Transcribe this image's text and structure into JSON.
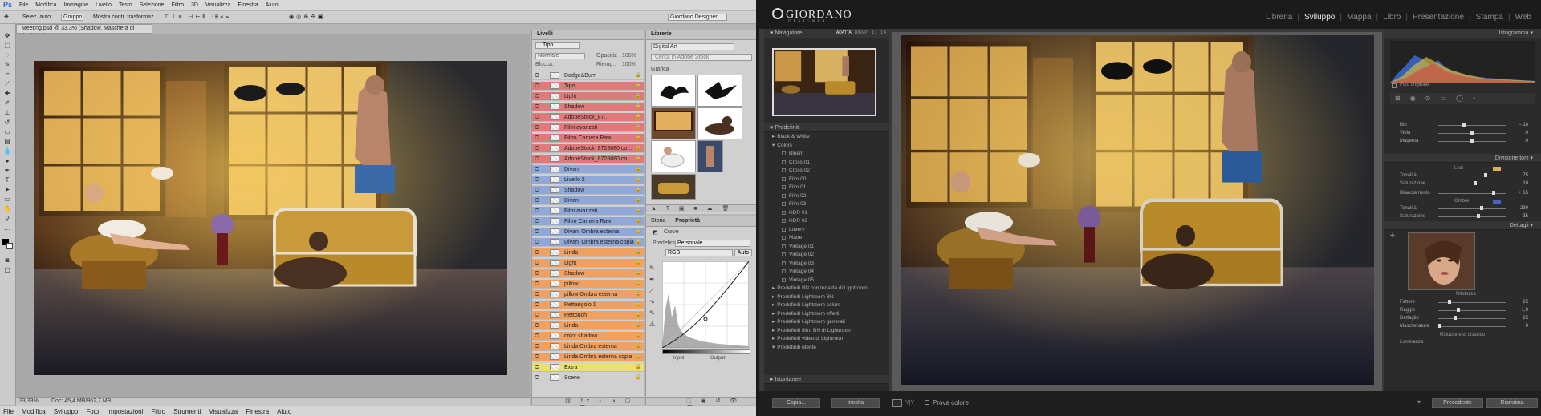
{
  "photoshop": {
    "menu": [
      "File",
      "Modifica",
      "Immagine",
      "Livello",
      "Testo",
      "Selezione",
      "Filtro",
      "3D",
      "Visualizza",
      "Finestra",
      "Aiuto"
    ],
    "options": {
      "auto_select": "Selez. auto:",
      "group_value": "Gruppo",
      "transform": "Mostra contr. trasformaz.",
      "workspace": "Giordano Designer"
    },
    "doc_tab": "Meeting.psd @ 33,3% (Shadow, Maschera di livello/16) *",
    "status": {
      "zoom": "33,33%",
      "doc": "Doc: 45,4 MB/962,7 MB"
    },
    "layers_panel": {
      "title": "Livelli",
      "kind": "Tipo",
      "blend": "Normale",
      "opacity_label": "Opacità:",
      "opacity": "100%",
      "lock_label": "Blocca:",
      "fill_label": "Riemp.:",
      "fill": "100%",
      "layers": [
        {
          "name": "Dodge&Burn",
          "color": "#d0d0d0"
        },
        {
          "name": "Tipo",
          "color": "#e07a7a"
        },
        {
          "name": "Light",
          "color": "#e07a7a"
        },
        {
          "name": "Shadow",
          "color": "#e07a7a"
        },
        {
          "name": "AdobeStock_87...",
          "color": "#e07a7a"
        },
        {
          "name": "Filtri avanzati",
          "color": "#e07a7a"
        },
        {
          "name": "Filtro Camera Raw",
          "color": "#e07a7a"
        },
        {
          "name": "AdobeStock_8728880 co...",
          "color": "#e07a7a"
        },
        {
          "name": "AdobeStock_8728880 co...",
          "color": "#e07a7a"
        },
        {
          "name": "Divani",
          "color": "#8fa8d8"
        },
        {
          "name": "Livello 2",
          "color": "#8fa8d8"
        },
        {
          "name": "Shadow",
          "color": "#8fa8d8"
        },
        {
          "name": "Divani",
          "color": "#8fa8d8"
        },
        {
          "name": "Filtri avanzati",
          "color": "#8fa8d8"
        },
        {
          "name": "Filtro Camera Raw",
          "color": "#8fa8d8"
        },
        {
          "name": "Divani Ombra esterna",
          "color": "#8fa8d8"
        },
        {
          "name": "Divani Ombra esterna copia",
          "color": "#8fa8d8"
        },
        {
          "name": "Linda",
          "color": "#f0a060"
        },
        {
          "name": "Light",
          "color": "#f0a060"
        },
        {
          "name": "Shadow",
          "color": "#f0a060"
        },
        {
          "name": "pillow",
          "color": "#f0a060"
        },
        {
          "name": "pillow Ombra esterna",
          "color": "#f0a060"
        },
        {
          "name": "Rettangolo 1",
          "color": "#f0a060"
        },
        {
          "name": "Rettouch",
          "color": "#f0a060"
        },
        {
          "name": "Linda",
          "color": "#f0a060"
        },
        {
          "name": "color shadow",
          "color": "#f0a060"
        },
        {
          "name": "Linda Ombra esterna",
          "color": "#f0a060"
        },
        {
          "name": "Linda Ombra esterna copia",
          "color": "#f0a060"
        },
        {
          "name": "Extra",
          "color": "#e8e070"
        },
        {
          "name": "Scene",
          "color": "#d0d0d0"
        }
      ]
    },
    "library_panel": {
      "title": "Librerie",
      "library": "Digital Art",
      "search": "Cerca in Adobe Stock",
      "section": "Grafica"
    },
    "properties_panel": {
      "tabs": [
        "Storia",
        "Proprietà"
      ],
      "type": "Curve",
      "preset_label": "Predefinito:",
      "preset": "Personale",
      "channel": "RGB",
      "auto": "Auto",
      "input_label": "Input:",
      "output_label": "Output:"
    },
    "taskbar": [
      "File",
      "Modifica",
      "Sviluppo",
      "Foto",
      "Impostazioni",
      "Filtro",
      "Strumenti",
      "Visualizza",
      "Finestra",
      "Aiuto"
    ]
  },
  "lightroom": {
    "logo": "GIORDANO",
    "logo_sub": "DESIGNER",
    "modules": [
      "Libreria",
      "Sviluppo",
      "Mappa",
      "Libro",
      "Presentazione",
      "Stampa",
      "Web"
    ],
    "active_module": "Sviluppo",
    "navigator": {
      "title": "Navigatore",
      "zoom": [
        "ADATTA",
        "RIEMPI",
        "1:1",
        "1:4"
      ]
    },
    "presets": {
      "title": "Predefiniti",
      "items": [
        {
          "label": "Black & White",
          "indent": 1,
          "arrow": "▸"
        },
        {
          "label": "Colors",
          "indent": 1,
          "arrow": "▾"
        },
        {
          "label": "Bluem",
          "indent": 2,
          "arrow": ""
        },
        {
          "label": "Cross 01",
          "indent": 2,
          "arrow": ""
        },
        {
          "label": "Cross 02",
          "indent": 2,
          "arrow": ""
        },
        {
          "label": "Film 00",
          "indent": 2,
          "arrow": ""
        },
        {
          "label": "Film 01",
          "indent": 2,
          "arrow": ""
        },
        {
          "label": "Film 02",
          "indent": 2,
          "arrow": ""
        },
        {
          "label": "Film 03",
          "indent": 2,
          "arrow": ""
        },
        {
          "label": "HDR 01",
          "indent": 2,
          "arrow": ""
        },
        {
          "label": "HDR 02",
          "indent": 2,
          "arrow": ""
        },
        {
          "label": "Lovery",
          "indent": 2,
          "arrow": ""
        },
        {
          "label": "Matte",
          "indent": 2,
          "arrow": ""
        },
        {
          "label": "Vintage 01",
          "indent": 2,
          "arrow": ""
        },
        {
          "label": "Vintage 02",
          "indent": 2,
          "arrow": ""
        },
        {
          "label": "Vintage 03",
          "indent": 2,
          "arrow": ""
        },
        {
          "label": "Vintage 04",
          "indent": 2,
          "arrow": ""
        },
        {
          "label": "Vintage 05",
          "indent": 2,
          "arrow": ""
        },
        {
          "label": "Predefiniti BN con tonalità di Lightroom",
          "indent": 1,
          "arrow": "▸"
        },
        {
          "label": "Predefiniti Lightroom BN",
          "indent": 1,
          "arrow": "▸"
        },
        {
          "label": "Predefiniti Lightroom colore",
          "indent": 1,
          "arrow": "▸"
        },
        {
          "label": "Predefiniti Lightroom effetti",
          "indent": 1,
          "arrow": "▸"
        },
        {
          "label": "Predefiniti Lightroom generali",
          "indent": 1,
          "arrow": "▸"
        },
        {
          "label": "Predefiniti filtro BN di Lightroom",
          "indent": 1,
          "arrow": "▸"
        },
        {
          "label": "Predefiniti video di Lightroom",
          "indent": 1,
          "arrow": "▸"
        },
        {
          "label": "Predefiniti utente",
          "indent": 1,
          "arrow": "▾"
        }
      ]
    },
    "snapshots": "Istantanee",
    "copy_btn": "Copia...",
    "paste_btn": "Incolla",
    "soft_proof": "Prova colore",
    "prev_btn": "Precedente",
    "reset_btn": "Ripristina",
    "right": {
      "histogram": "Istogramma",
      "original_photo": "Foto originale",
      "color_group": [
        {
          "label": "Blu",
          "value": "– 18",
          "pos": 0.38
        },
        {
          "label": "Viola",
          "value": "0",
          "pos": 0.5
        },
        {
          "label": "Magenta",
          "value": "0",
          "pos": 0.5
        }
      ],
      "split_toning": {
        "title": "Divisione toni",
        "highlights": "Luci",
        "hl": [
          {
            "label": "Tonalità",
            "value": "75",
            "pos": 0.7
          },
          {
            "label": "Saturazione",
            "value": "10",
            "pos": 0.55
          }
        ],
        "balance": {
          "label": "Bilanciamento",
          "value": "+ 65",
          "pos": 0.82
        },
        "shadows": "Ombre",
        "sh": [
          {
            "label": "Tonalità",
            "value": "230",
            "pos": 0.64
          },
          {
            "label": "Saturazione",
            "value": "35",
            "pos": 0.6
          }
        ]
      },
      "details": {
        "title": "Dettagli",
        "sharpening": "Nitidezza",
        "sharp": [
          {
            "label": "Fattore",
            "value": "25",
            "pos": 0.17
          },
          {
            "label": "Raggio",
            "value": "1,0",
            "pos": 0.3
          },
          {
            "label": "Dettaglio",
            "value": "25",
            "pos": 0.25
          },
          {
            "label": "Mascheratura",
            "value": "0",
            "pos": 0.02
          }
        ],
        "noise": "Riduzione di disturbo",
        "luminance": "Luminanza"
      }
    }
  }
}
